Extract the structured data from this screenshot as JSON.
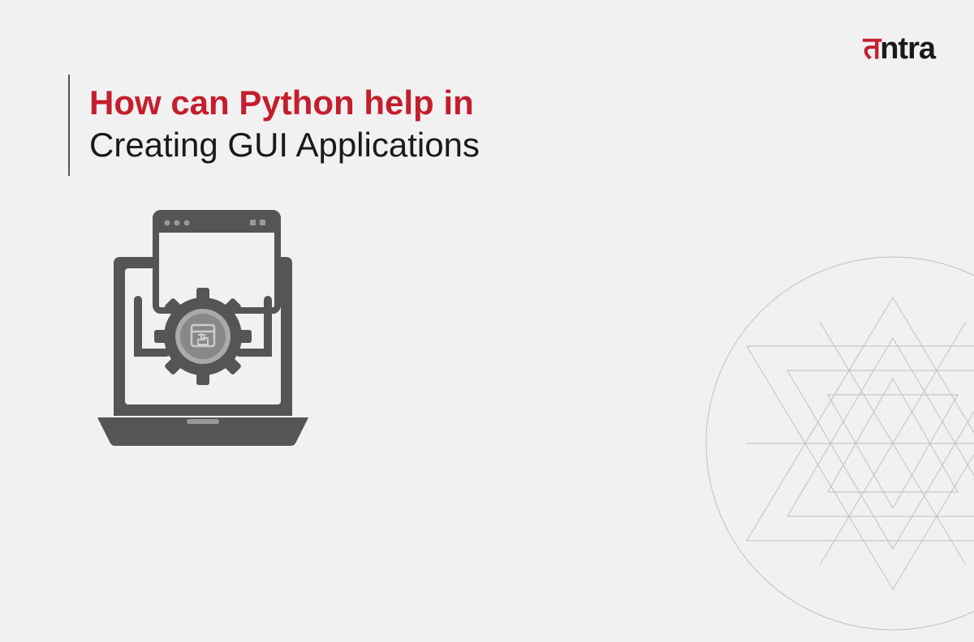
{
  "logo": {
    "text_part1": "त",
    "text_part2": "ntra"
  },
  "title": {
    "line1": "How can Python help in",
    "line2": "Creating GUI Applications"
  },
  "illustration": {
    "name": "laptop-gui-python-icon"
  }
}
